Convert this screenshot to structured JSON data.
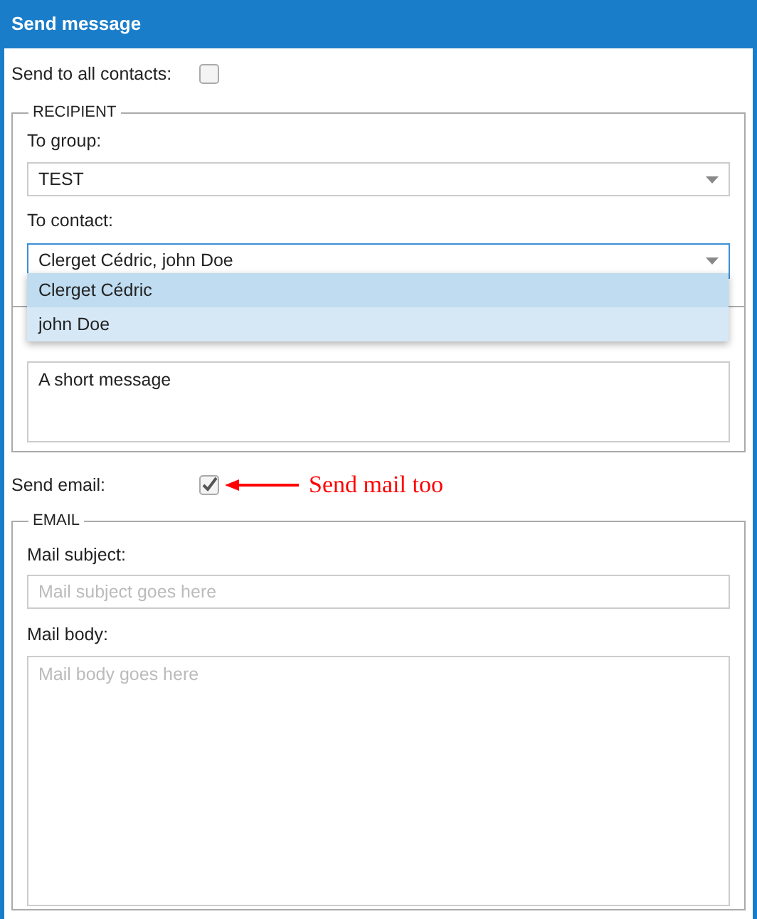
{
  "window": {
    "title": "Send message"
  },
  "send_to_all": {
    "label": "Send to all contacts:",
    "checked": false
  },
  "recipient": {
    "legend": "RECIPIENT",
    "group": {
      "label": "To group:",
      "value": "TEST"
    },
    "contact": {
      "label": "To contact:",
      "value": "Clerget Cédric, john Doe",
      "expanded": true,
      "options": [
        {
          "label": "Clerget Cédric",
          "selected": true
        },
        {
          "label": "john Doe",
          "selected": false
        }
      ]
    }
  },
  "message": {
    "value": "A short message"
  },
  "send_email": {
    "label": "Send email:",
    "checked": true
  },
  "annotation": {
    "text": "Send mail too"
  },
  "email": {
    "legend": "EMAIL",
    "subject": {
      "label": "Mail subject:",
      "placeholder": "Mail subject goes here"
    },
    "body": {
      "label": "Mail body:",
      "placeholder": "Mail body goes here"
    }
  }
}
